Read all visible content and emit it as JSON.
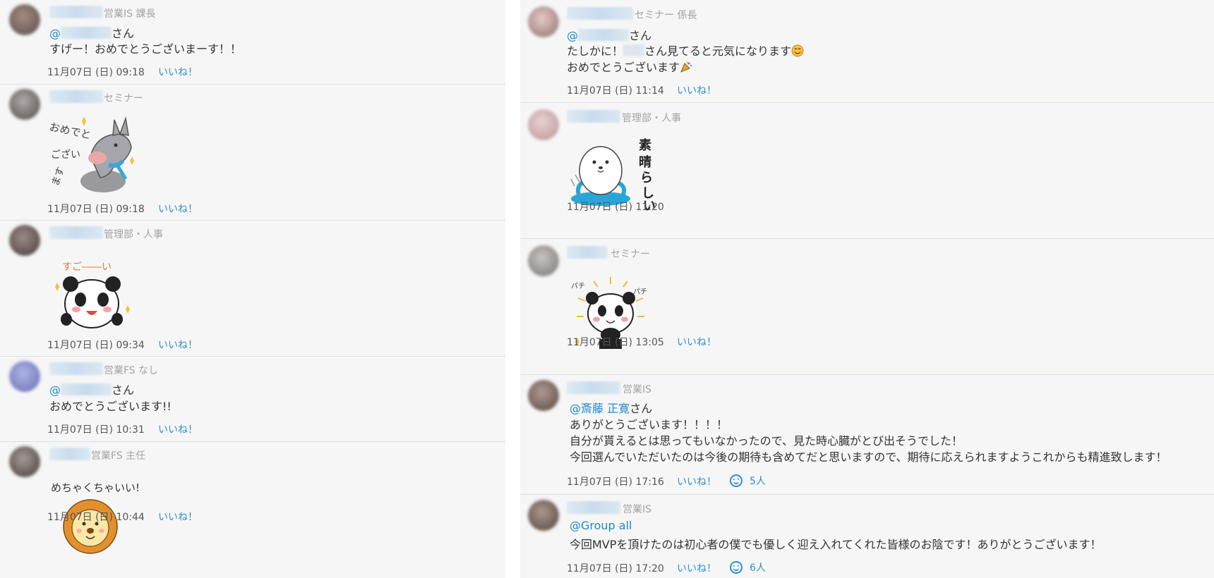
{
  "left_posts": [
    {
      "dept": "営業IS 課長",
      "mention_prefix": "@",
      "mention_suffix": "さん",
      "line1": "すげー！おめでとうございまーす！！",
      "timestamp": "11月07日 (日) 09:18",
      "like": "いいね！"
    },
    {
      "dept": "セミナー",
      "sticker_text": "おめでとうございます",
      "timestamp": "11月07日 (日) 09:18",
      "like": "いいね！"
    },
    {
      "dept": "管理部・人事",
      "sticker_text": "すご――い",
      "timestamp": "11月07日 (日) 09:34",
      "like": "いいね！"
    },
    {
      "dept": "営業FS なし",
      "mention_prefix": "@",
      "mention_suffix": "さん",
      "line1": "おめでとうございます!!",
      "timestamp": "11月07日 (日) 10:31",
      "like": "いいね！"
    },
    {
      "dept": "営業FS 主任",
      "sticker_text": "めちゃくちゃいい!!",
      "timestamp": "11月07日 (日) 10:44",
      "like": "いいね！"
    }
  ],
  "right_posts": [
    {
      "dept": "セミナー 係長",
      "mention_prefix": "@",
      "mention_suffix": "さん",
      "line1_a": "たしかに！",
      "line1_b": "さん見てると元気になります",
      "line2": "おめでとうございます",
      "timestamp": "11月07日 (日) 11:14",
      "like": "いいね！"
    },
    {
      "dept": "管理部・人事",
      "sticker_text": "素晴らしい！",
      "timestamp": "11月07日 (日) 11:20"
    },
    {
      "dept": "セミナー",
      "sticker_text": "パチ",
      "timestamp": "11月07日 (日) 13:05",
      "like": "いいね！"
    },
    {
      "dept": "営業IS",
      "mention": "@斎藤 正寛",
      "mention_suffix": "さん",
      "line1": "ありがとうございます！！！！",
      "line2": "自分が貰えるとは思ってもいなかったので、見た時心臓がとび出そうでした！",
      "line3": "今回選んでいただいたのは今後の期待も含めてだと思いますので、期待に応えられますようこれからも精進致します！",
      "timestamp": "11月07日 (日) 17:16",
      "like": "いいね！",
      "reactions": "5人"
    },
    {
      "dept": "営業IS",
      "mention": "@Group all",
      "line1": "今回MVPを頂けたのは初心者の僕でも優しく迎え入れてくれた皆様のお陰です！ありがとうございます！",
      "timestamp": "11月07日 (日) 17:20",
      "like": "いいね！",
      "reactions": "6人"
    }
  ],
  "colors": {
    "link": "#1e88c7",
    "background": "#f6f6f7",
    "divider": "#dcdfe6"
  }
}
